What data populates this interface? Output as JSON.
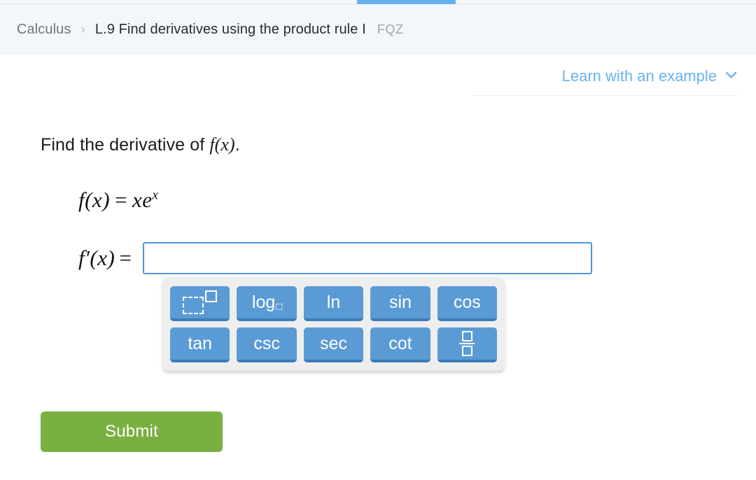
{
  "topbar": {
    "progress_label": "progress-indicator",
    "accent_color": "#64b0ec"
  },
  "header": {
    "course": "Calculus",
    "separator": "›",
    "skill": "L.9 Find derivatives using the product rule I",
    "code": "FQZ"
  },
  "learn": {
    "label": "Learn with an example",
    "chevron": "chevron-down-icon"
  },
  "question": {
    "prefix": "Find the derivative of ",
    "function": "f(x)",
    "suffix": "."
  },
  "equation": {
    "lhs": "f(x)",
    "operator": "=",
    "rhs_base": "xe",
    "rhs_exponent": "x"
  },
  "answer": {
    "label": "f′(x)",
    "operator": "=",
    "value": "",
    "placeholder": ""
  },
  "keypad": {
    "rows": [
      [
        {
          "label": "",
          "icon": "exponent-icon",
          "name": "key-exponent"
        },
        {
          "label": "log",
          "sub": "□",
          "name": "key-log"
        },
        {
          "label": "ln",
          "name": "key-ln"
        },
        {
          "label": "sin",
          "name": "key-sin"
        },
        {
          "label": "cos",
          "name": "key-cos"
        }
      ],
      [
        {
          "label": "tan",
          "name": "key-tan"
        },
        {
          "label": "csc",
          "name": "key-csc"
        },
        {
          "label": "sec",
          "name": "key-sec"
        },
        {
          "label": "cot",
          "name": "key-cot"
        },
        {
          "label": "",
          "icon": "fraction-icon",
          "name": "key-fraction"
        }
      ]
    ],
    "button_color": "#5b9bd5"
  },
  "submit": {
    "label": "Submit",
    "color": "#7ab040"
  }
}
